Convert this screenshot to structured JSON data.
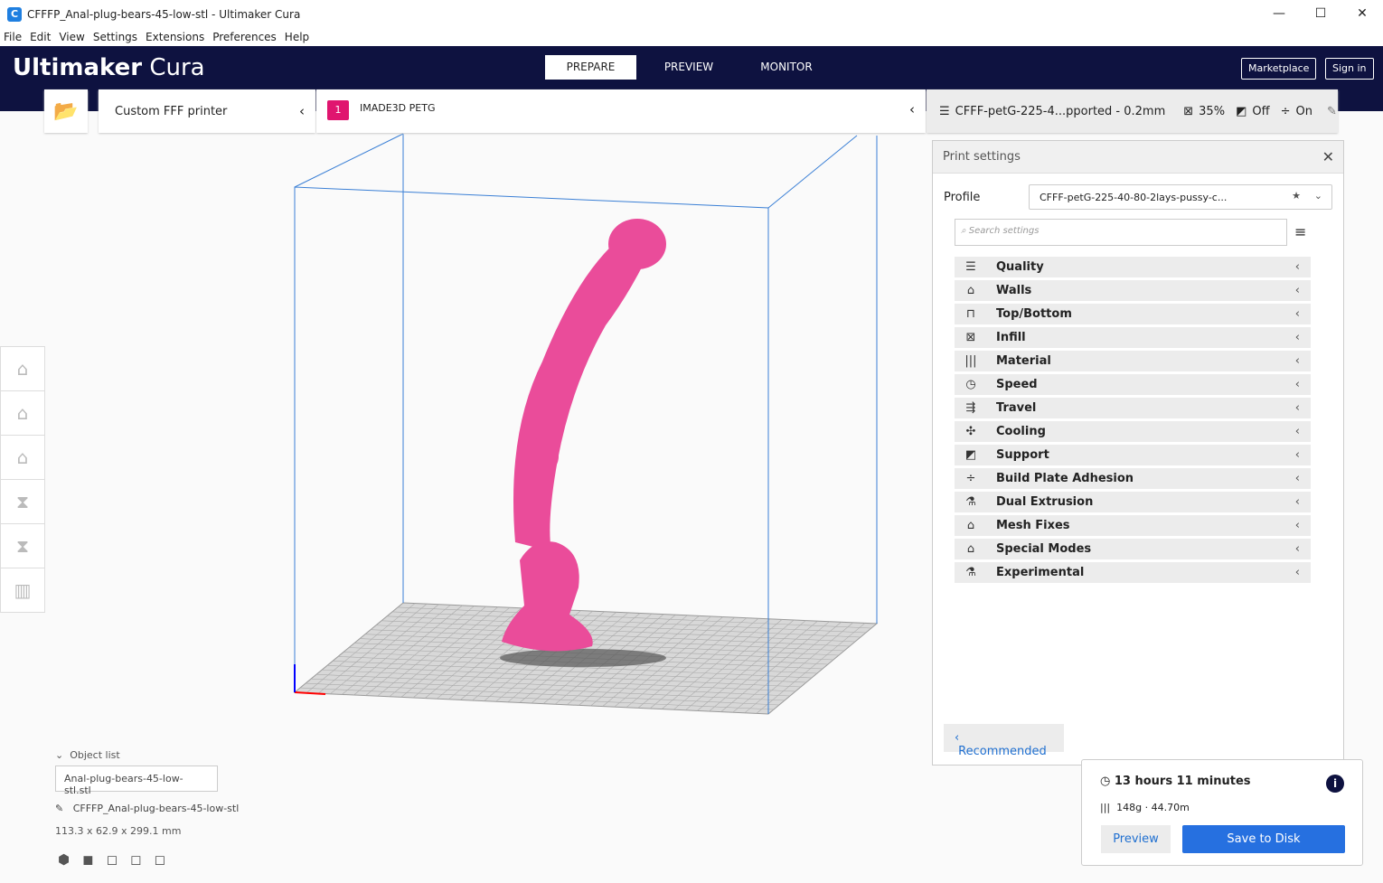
{
  "window": {
    "title": "CFFFP_Anal-plug-bears-45-low-stl - Ultimaker Cura",
    "minimize": "—",
    "maximize": "☐",
    "close": "✕"
  },
  "menu": [
    "File",
    "Edit",
    "View",
    "Settings",
    "Extensions",
    "Preferences",
    "Help"
  ],
  "header": {
    "brand_bold": "Ultimaker",
    "brand": " Cura",
    "tabs": [
      "PREPARE",
      "PREVIEW",
      "MONITOR"
    ],
    "marketplace": "Marketplace",
    "signin": "Sign in"
  },
  "printer": {
    "name": "Custom FFF printer",
    "material_badge": "1",
    "material": "IMADE3D PETG"
  },
  "settings_summary": {
    "profile": "CFFF-petG-225-4...pported - 0.2mm",
    "infill": "35%",
    "support": "Off",
    "adhesion": "On"
  },
  "panel": {
    "title": "Print settings",
    "profile_label": "Profile",
    "profile_value": "CFFF-petG-225-40-80-2lays-pussy-c...",
    "search_placeholder": "Search settings",
    "recommended": "Recommended",
    "categories": [
      {
        "label": "Quality",
        "icon": "☰"
      },
      {
        "label": "Walls",
        "icon": "⌂"
      },
      {
        "label": "Top/Bottom",
        "icon": "⊓"
      },
      {
        "label": "Infill",
        "icon": "⊠"
      },
      {
        "label": "Material",
        "icon": "|||"
      },
      {
        "label": "Speed",
        "icon": "◷"
      },
      {
        "label": "Travel",
        "icon": "⇶"
      },
      {
        "label": "Cooling",
        "icon": "✣"
      },
      {
        "label": "Support",
        "icon": "◩"
      },
      {
        "label": "Build Plate Adhesion",
        "icon": "÷"
      },
      {
        "label": "Dual Extrusion",
        "icon": "⚗"
      },
      {
        "label": "Mesh Fixes",
        "icon": "⌂"
      },
      {
        "label": "Special Modes",
        "icon": "⌂"
      },
      {
        "label": "Experimental",
        "icon": "⚗"
      }
    ]
  },
  "objects": {
    "header": "Object list",
    "item": "Anal-plug-bears-45-low-stl.stl",
    "name": "CFFFP_Anal-plug-bears-45-low-stl",
    "dimensions": "113.3 x 62.9 x 299.1 mm"
  },
  "job": {
    "time": "13 hours 11 minutes",
    "material": "148g · 44.70m",
    "preview": "Preview",
    "save": "Save to Disk"
  }
}
